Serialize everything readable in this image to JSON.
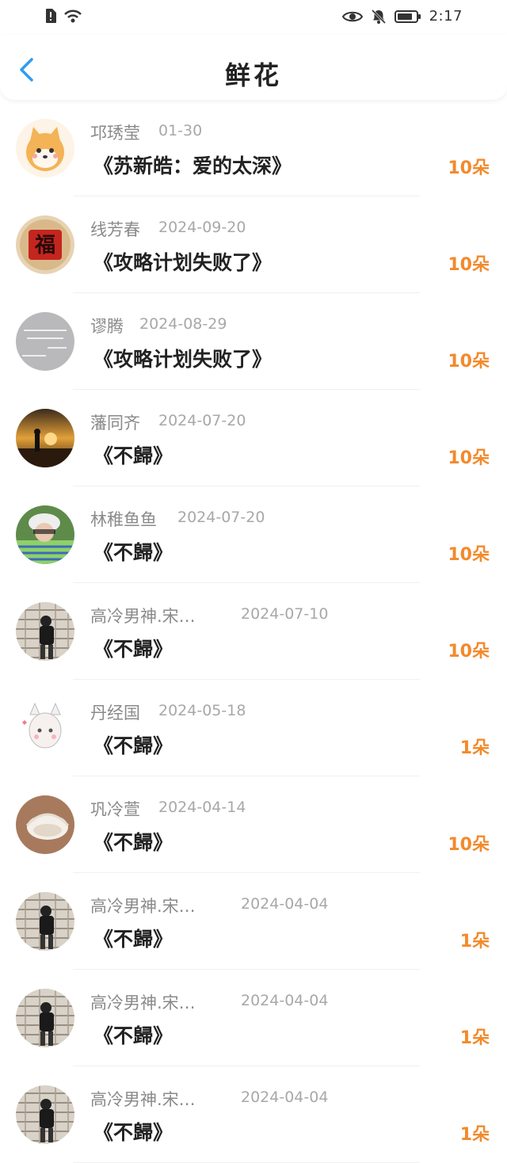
{
  "status": {
    "time": "2:17"
  },
  "header": {
    "title": "鲜花"
  },
  "rows": [
    {
      "name": "邛琇莹",
      "date": "01-30",
      "song": "《苏新皓：爱的太深》",
      "count": "10朵"
    },
    {
      "name": "线芳春",
      "date": "2024-09-20",
      "song": "《攻略计划失败了》",
      "count": "10朵"
    },
    {
      "name": "谬腾",
      "date": "2024-08-29",
      "song": "《攻略计划失败了》",
      "count": "10朵"
    },
    {
      "name": "藩同齐",
      "date": "2024-07-20",
      "song": "《不歸》",
      "count": "10朵"
    },
    {
      "name": "林稚鱼鱼",
      "date": "2024-07-20",
      "song": "《不歸》",
      "count": "10朵"
    },
    {
      "name": "高冷男神.宋…",
      "date": "2024-07-10",
      "song": "《不歸》",
      "count": "10朵"
    },
    {
      "name": "丹经国",
      "date": "2024-05-18",
      "song": "《不歸》",
      "count": "1朵"
    },
    {
      "name": "巩冷萱",
      "date": "2024-04-14",
      "song": "《不歸》",
      "count": "10朵"
    },
    {
      "name": "高冷男神.宋…",
      "date": "2024-04-04",
      "song": "《不歸》",
      "count": "1朵"
    },
    {
      "name": "高冷男神.宋…",
      "date": "2024-04-04",
      "song": "《不歸》",
      "count": "1朵"
    },
    {
      "name": "高冷男神.宋…",
      "date": "2024-04-04",
      "song": "《不歸》",
      "count": "1朵"
    }
  ]
}
